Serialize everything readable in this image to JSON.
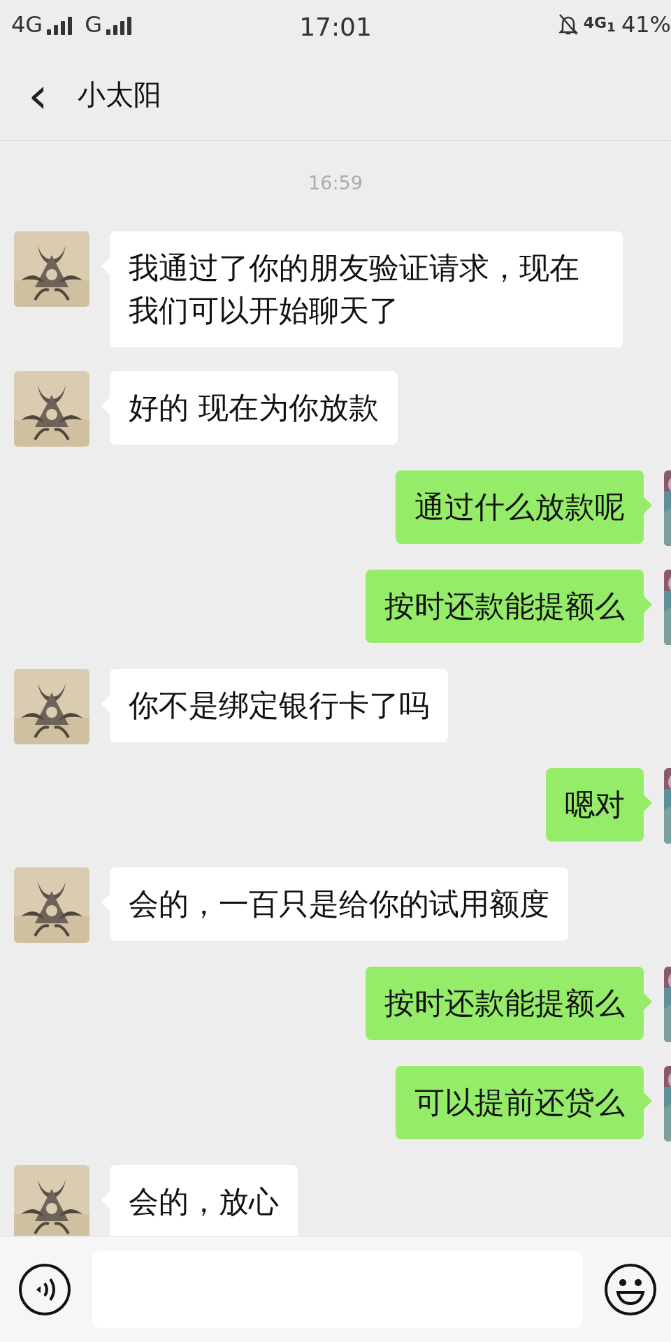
{
  "status_bar": {
    "network_1": "4G",
    "network_2": "G",
    "time": "17:01",
    "network_3": "4G$_{1}$",
    "battery": "41%"
  },
  "header": {
    "back": "‹",
    "title": "小太阳"
  },
  "timestamp": "16:59",
  "messages": [
    {
      "kind": "received",
      "text": "我通过了你的朋友验证请求，现在我们可以开始聊天了"
    },
    {
      "kind": "received",
      "text": "好的 现在为你放款"
    },
    {
      "kind": "sent",
      "text": "通过什么放款呢"
    },
    {
      "kind": "sent",
      "text": "按时还款能提额么"
    },
    {
      "kind": "received",
      "text": "你不是绑定银行卡了吗"
    },
    {
      "kind": "sent",
      "text": "嗯对"
    },
    {
      "kind": "received",
      "text": "会的，一百只是给你的试用额度"
    },
    {
      "kind": "sent",
      "text": "按时还款能提额么"
    },
    {
      "kind": "sent",
      "text": "可以提前还贷么"
    },
    {
      "kind": "received",
      "text": "会的，放心"
    }
  ]
}
